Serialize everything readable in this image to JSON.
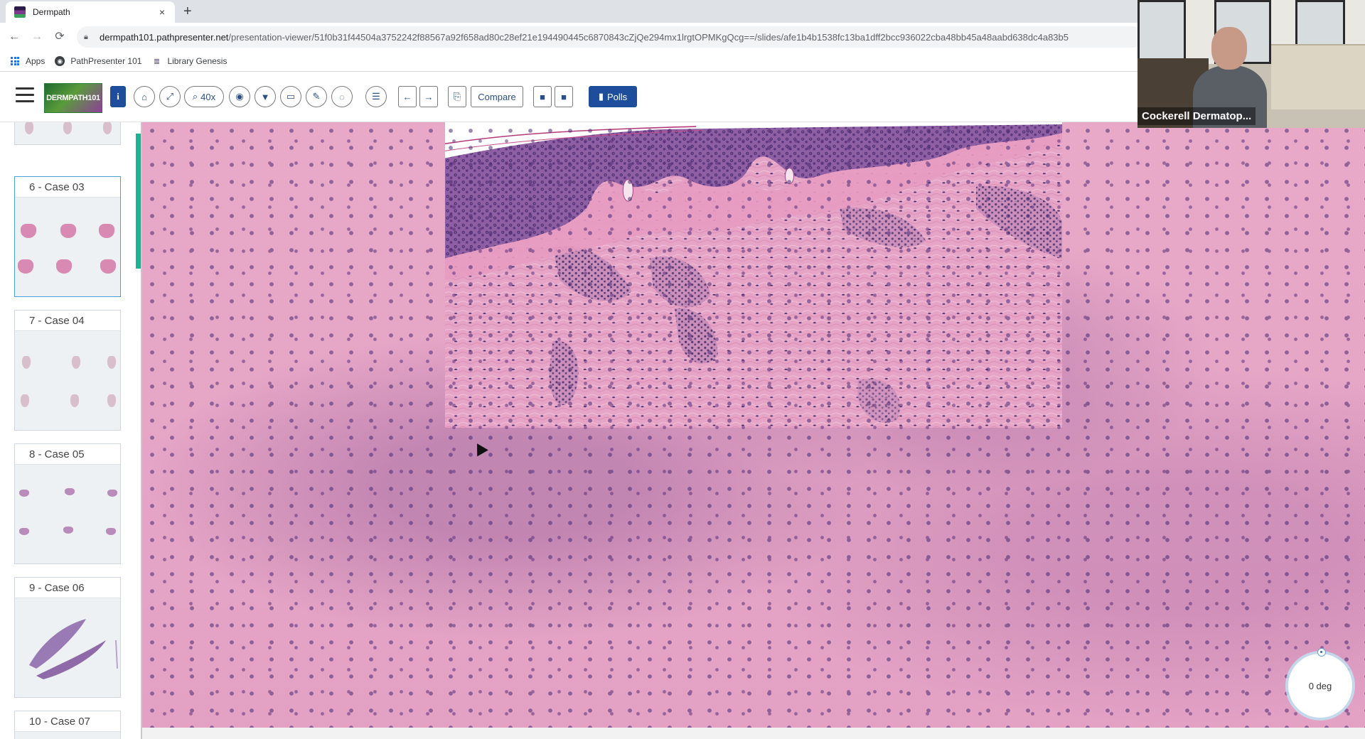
{
  "browser": {
    "tab_title": "Dermpath",
    "tab_close": "×",
    "new_tab": "+",
    "back": "←",
    "forward": "→",
    "reload": "⟳",
    "url_host": "dermpath101.pathpresenter.net",
    "url_path": "/presentation-viewer/51f0b31f44504a3752242f88567a92f658ad80c28ef21e194490445c6870843cZjQe294mx1lrgtOPMKgQcg==/slides/afe1b4b1538fc13ba1dff2bcc936022cba48bb45a48aabd638dc4a83b5"
  },
  "bookmarks": [
    {
      "label": "Apps",
      "icon": "apps-grid-icon"
    },
    {
      "label": "PathPresenter 101",
      "icon": "globe-icon"
    },
    {
      "label": "Library Genesis",
      "icon": "book-icon"
    }
  ],
  "toolbar": {
    "logo_text": "DERMPATH101",
    "info_label": "i",
    "zoom_label": "40x",
    "compare_label": "Compare",
    "polls_label": "Polls"
  },
  "sidebar": {
    "cards": [
      {
        "label": "6 - Case 03"
      },
      {
        "label": "7 - Case 04"
      },
      {
        "label": "8 - Case 05"
      },
      {
        "label": "9 - Case 06"
      },
      {
        "label": "10 - Case 07"
      }
    ]
  },
  "viewer": {
    "rotation_label": "0 deg"
  },
  "webcam": {
    "name": "Cockerell Dermatop..."
  }
}
